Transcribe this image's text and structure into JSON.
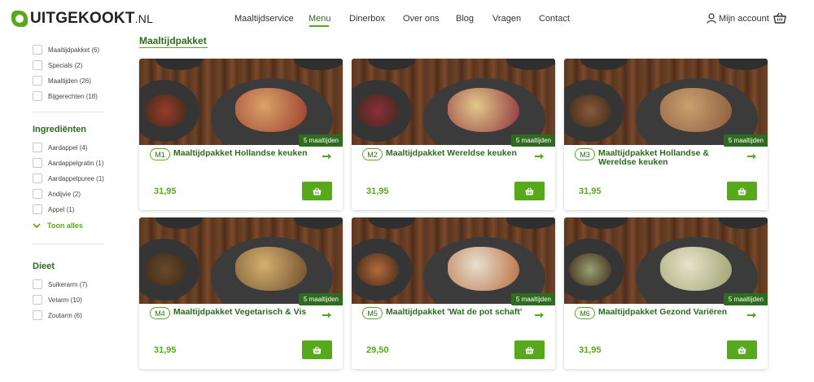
{
  "brand": {
    "name": "UITGEKOOKT",
    "suffix": ".NL"
  },
  "nav": {
    "items": [
      "Maaltijdservice",
      "Menu",
      "Dinerbox",
      "Over ons",
      "Blog",
      "Vragen",
      "Contact"
    ],
    "active": "Menu"
  },
  "account": {
    "label": "Mijn account"
  },
  "icons": {
    "logo": "leaf-logo-icon",
    "account": "user-icon",
    "cart": "basket-icon",
    "arrow": "arrow-right-icon",
    "chevron": "chevron-down-icon"
  },
  "colors": {
    "accent": "#58a81c",
    "dark_green": "#2c6b1f",
    "badge": "#2f6b1e"
  },
  "sidebar": {
    "categories": [
      "Maaltijdpakket (6)",
      "Specials (2)",
      "Maaltijden (26)",
      "Bijgerechten (18)"
    ],
    "ingredients_heading": "Ingrediënten",
    "ingredients": [
      "Aardappel (4)",
      "Aardappelgratin (1)",
      "Aardappelpuree (1)",
      "Andijvie (2)",
      "Appel (1)"
    ],
    "show_all": "Toon alles",
    "diet_heading": "Dieet",
    "diet": [
      "Suikerarm (7)",
      "Vetarm (10)",
      "Zoutarm (6)"
    ]
  },
  "section": {
    "title": "Maaltijdpakket"
  },
  "products": [
    {
      "code": "M1",
      "title": "Maaltijdpakket Hollandse keuken",
      "badge": "5 maaltijden",
      "price": "31,95"
    },
    {
      "code": "M2",
      "title": "Maaltijdpakket Wereldse keuken",
      "badge": "5 maaltijden",
      "price": "31,95"
    },
    {
      "code": "M3",
      "title": "Maaltijdpakket Hollandse & Wereldse keuken",
      "badge": "5 maaltijden",
      "price": "31,95"
    },
    {
      "code": "M4",
      "title": "Maaltijdpakket Vegetarisch & Vis",
      "badge": "5 maaltijden",
      "price": "31,95"
    },
    {
      "code": "M5",
      "title": "Maaltijdpakket 'Wat de pot schaft'",
      "badge": "5 maaltijden",
      "price": "29,50"
    },
    {
      "code": "M6",
      "title": "Maaltijdpakket Gezond Variëren",
      "badge": "5 maaltijden",
      "price": "31,95"
    }
  ]
}
